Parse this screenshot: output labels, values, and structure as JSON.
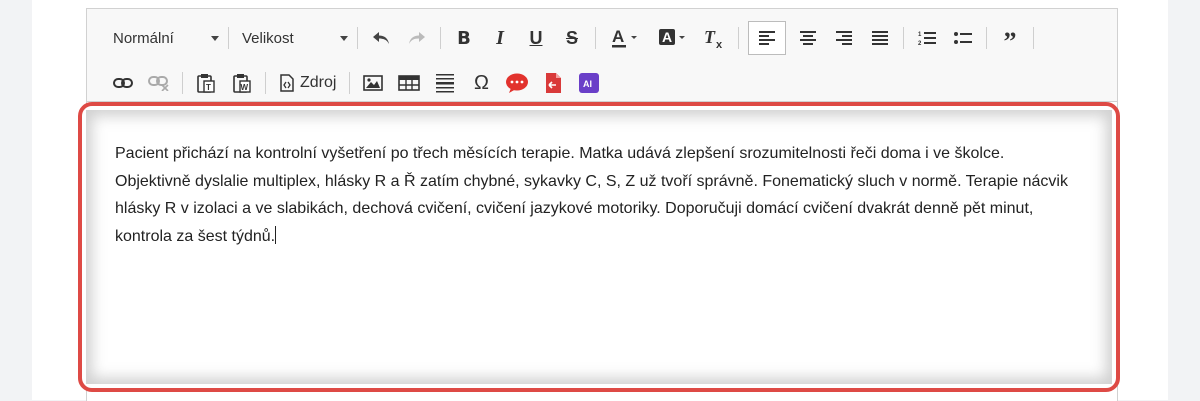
{
  "toolbar": {
    "format_combo": "Normální",
    "size_combo": "Velikost",
    "source_label": "Zdroj"
  },
  "editor": {
    "body_text": "Pacient přichází na kontrolní vyšetření po třech měsících terapie. Matka udává zlepšení srozumitelnosti řeči doma i ve školce. Objektivně dyslalie multiplex, hlásky R a Ř zatím chybné, sykavky C, S, Z už tvoří správně. Fonematický sluch v normě. Terapie nácvik hlásky R v izolaci a ve slabikách, dechová cvičení, cvičení jazykové motoriky. Doporučuji domácí cvičení dvakrát denně pět minut, kontrola za šest týdnů."
  },
  "icons": {
    "row1": [
      "undo-icon",
      "redo-icon",
      "bold-icon",
      "italic-icon",
      "underline-icon",
      "strikethrough-icon",
      "text-color-icon",
      "background-color-icon",
      "remove-format-icon",
      "align-left-icon",
      "align-center-icon",
      "align-right-icon",
      "align-justify-icon",
      "numbered-list-icon",
      "bulleted-list-icon",
      "blockquote-icon"
    ],
    "row2": [
      "link-icon",
      "unlink-icon",
      "paste-text-icon",
      "paste-word-icon",
      "source-icon",
      "image-icon",
      "table-icon",
      "horizontal-line-icon",
      "special-char-icon",
      "comment-icon",
      "pdf-icon",
      "ai-icon"
    ]
  },
  "colors": {
    "focus_border": "#de4a45",
    "comment_icon": "#e2322d",
    "pdf_icon": "#d93a3a",
    "ai_icon": "#6a3fc8"
  }
}
